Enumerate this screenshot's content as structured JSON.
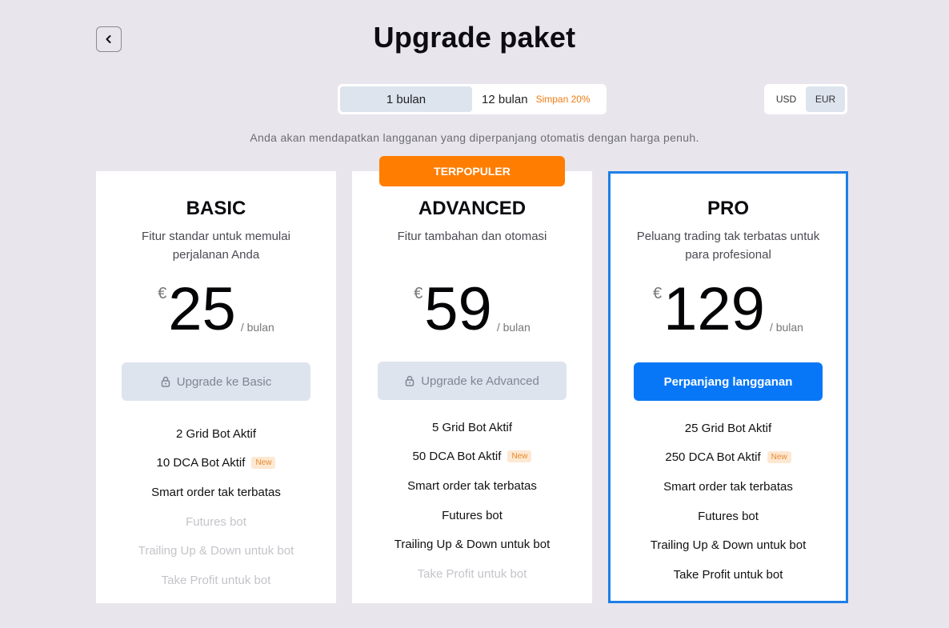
{
  "header": {
    "title": "Upgrade paket",
    "back_icon": "chevron-left-icon"
  },
  "billing_period": {
    "options": [
      {
        "label": "1 bulan",
        "selected": true
      },
      {
        "label": "12 bulan",
        "selected": false,
        "tag": "Simpan 20%"
      }
    ]
  },
  "currency": {
    "options": [
      {
        "label": "USD",
        "selected": false
      },
      {
        "label": "EUR",
        "selected": true
      }
    ]
  },
  "notice": "Anda akan mendapatkan langganan yang diperpanjang otomatis dengan harga penuh.",
  "popular_badge": "TERPOPULER",
  "colors": {
    "background": "#e8e5ec",
    "accent_blue": "#0877f7",
    "popular_orange": "#ff7d00",
    "save_orange": "#f07b12"
  },
  "plans": [
    {
      "name": "BASIC",
      "description": "Fitur standar untuk memulai perjalanan Anda",
      "currency_symbol": "€",
      "price": "25",
      "unit": "/ bulan",
      "cta_label": "Upgrade ke Basic",
      "cta_icon": "lock-icon",
      "cta_enabled": false,
      "current": false,
      "features": [
        {
          "label": "2 Grid Bot Aktif",
          "included": true,
          "badge": ""
        },
        {
          "label": "10 DCA Bot Aktif",
          "included": true,
          "badge": "New"
        },
        {
          "label": "Smart order tak terbatas",
          "included": true,
          "badge": ""
        },
        {
          "label": "Futures bot",
          "included": false,
          "badge": ""
        },
        {
          "label": "Trailing Up & Down untuk bot",
          "included": false,
          "badge": ""
        },
        {
          "label": "Take Profit untuk bot",
          "included": false,
          "badge": ""
        }
      ]
    },
    {
      "name": "ADVANCED",
      "description": "Fitur tambahan dan otomasi",
      "currency_symbol": "€",
      "price": "59",
      "unit": "/ bulan",
      "cta_label": "Upgrade ke Advanced",
      "cta_icon": "lock-icon",
      "cta_enabled": false,
      "current": false,
      "features": [
        {
          "label": "5 Grid Bot Aktif",
          "included": true,
          "badge": ""
        },
        {
          "label": "50 DCA Bot Aktif",
          "included": true,
          "badge": "New"
        },
        {
          "label": "Smart order tak terbatas",
          "included": true,
          "badge": ""
        },
        {
          "label": "Futures bot",
          "included": true,
          "badge": ""
        },
        {
          "label": "Trailing Up & Down untuk bot",
          "included": true,
          "badge": ""
        },
        {
          "label": "Take Profit untuk bot",
          "included": false,
          "badge": ""
        }
      ]
    },
    {
      "name": "PRO",
      "description": "Peluang trading tak terbatas untuk para profesional",
      "currency_symbol": "€",
      "price": "129",
      "unit": "/ bulan",
      "cta_label": "Perpanjang langganan",
      "cta_icon": "",
      "cta_enabled": true,
      "current": true,
      "features": [
        {
          "label": "25 Grid Bot Aktif",
          "included": true,
          "badge": ""
        },
        {
          "label": "250 DCA Bot Aktif",
          "included": true,
          "badge": "New"
        },
        {
          "label": "Smart order tak terbatas",
          "included": true,
          "badge": ""
        },
        {
          "label": "Futures bot",
          "included": true,
          "badge": ""
        },
        {
          "label": "Trailing Up & Down untuk bot",
          "included": true,
          "badge": ""
        },
        {
          "label": "Take Profit untuk bot",
          "included": true,
          "badge": ""
        }
      ]
    }
  ]
}
